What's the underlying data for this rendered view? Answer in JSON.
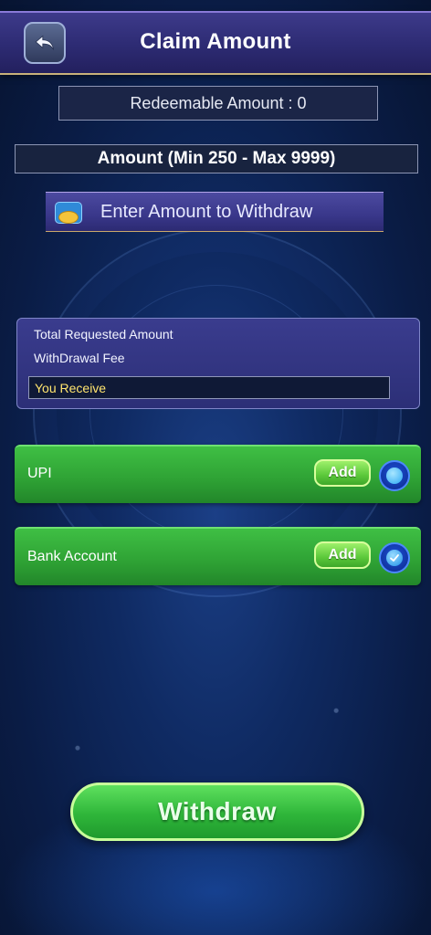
{
  "header": {
    "title": "Claim Amount"
  },
  "redeemable": {
    "label": "Redeemable Amount : 0"
  },
  "amount_field": {
    "label": "Amount (Min 250 - Max 9999)"
  },
  "enter_amount": {
    "placeholder": "Enter Amount to Withdraw",
    "icon": "wallet-coin-icon"
  },
  "summary": {
    "total_requested": "Total Requested Amount",
    "withdrawal_fee": "WithDrawal Fee",
    "you_receive": "You Receive"
  },
  "payment_methods": [
    {
      "label": "UPI",
      "add_label": "Add",
      "selected": false
    },
    {
      "label": "Bank Account",
      "add_label": "Add",
      "selected": true
    }
  ],
  "withdraw_button": {
    "label": "Withdraw"
  },
  "colors": {
    "accent_green": "#2ea134",
    "header_purple": "#2d2b73",
    "receive_text": "#ffe56e"
  }
}
